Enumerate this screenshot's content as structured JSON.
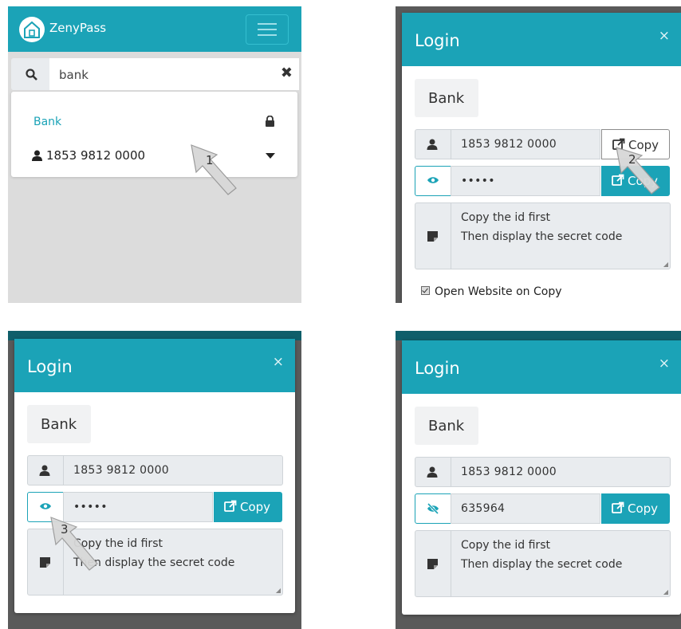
{
  "app": {
    "name": "ZenyPass"
  },
  "search": {
    "query": "bank"
  },
  "result": {
    "title": "Bank",
    "identifier": "1853 9812 0000"
  },
  "modal": {
    "title": "Login",
    "close": "×",
    "site": "Bank",
    "identifier": "1853 9812 0000",
    "password_masked": "•••••",
    "password_revealed": "635964",
    "copy_label": "Copy",
    "note_line1": "Copy the id first",
    "note_line2": "Then display the secret code",
    "open_website_label": "Open Website on Copy"
  },
  "callouts": {
    "step1": "1",
    "step2": "2",
    "step3": "3"
  },
  "colors": {
    "accent": "#1ba3b7",
    "field_bg": "#e9ecef",
    "backdrop": "#5a5a5a"
  },
  "icons": [
    "logo-icon",
    "menu-icon",
    "search-icon",
    "clear-icon",
    "lock-icon",
    "user-icon",
    "caret-down-icon",
    "eye-icon",
    "eye-slash-icon",
    "external-link-icon",
    "note-icon",
    "close-icon"
  ]
}
